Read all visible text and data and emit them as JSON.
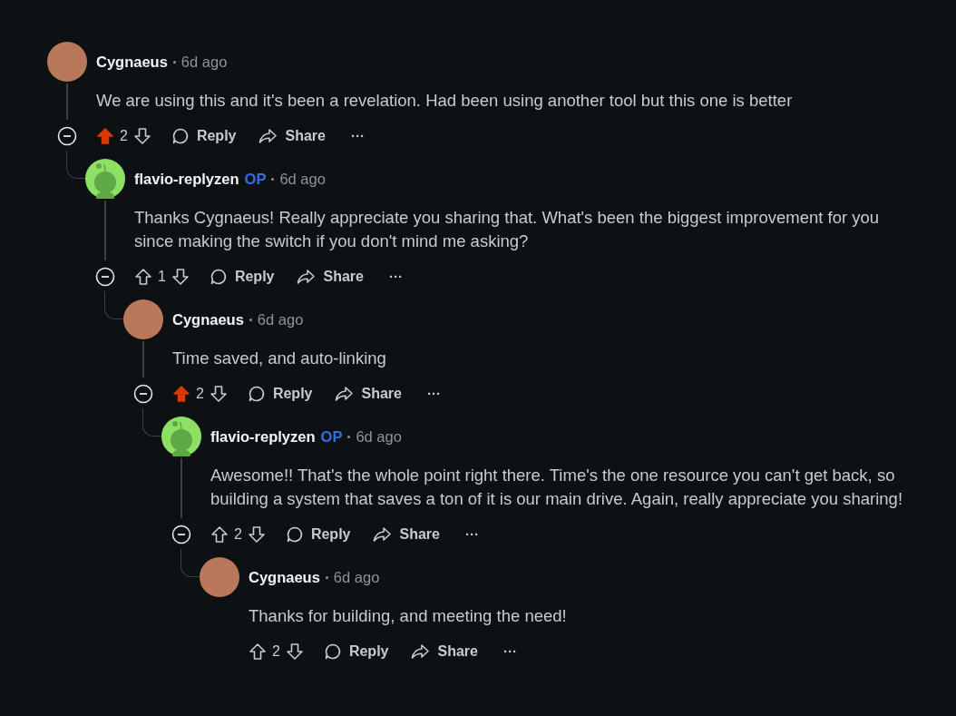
{
  "comments": [
    {
      "author": "Cygnaeus",
      "kind": "photo",
      "op": false,
      "time": "6d ago",
      "body": "We are using this and it's been a revelation. Had been using another tool but this one is better",
      "votes": "2",
      "upvoted": true,
      "actions": [
        "Reply",
        "Share"
      ],
      "more": "···",
      "children": [
        {
          "author": "flavio-replyzen",
          "kind": "snoo",
          "op": true,
          "op_label": "OP",
          "time": "6d ago",
          "body": "Thanks Cygnaeus! Really appreciate you sharing that. What's been the biggest improvement for you since making the switch if you don't mind me asking?",
          "votes": "1",
          "upvoted": false,
          "actions": [
            "Reply",
            "Share"
          ],
          "more": "···",
          "children": [
            {
              "author": "Cygnaeus",
              "kind": "photo",
              "op": false,
              "time": "6d ago",
              "body": "Time saved, and auto-linking",
              "votes": "2",
              "upvoted": true,
              "actions": [
                "Reply",
                "Share"
              ],
              "more": "···",
              "children": [
                {
                  "author": "flavio-replyzen",
                  "kind": "snoo",
                  "op": true,
                  "op_label": "OP",
                  "time": "6d ago",
                  "body": "Awesome!! That's the whole point right there. Time's the one resource you can't get back, so building a system that saves a ton of it is our main drive. Again, really appreciate you sharing!",
                  "votes": "2",
                  "upvoted": false,
                  "actions": [
                    "Reply",
                    "Share"
                  ],
                  "more": "···",
                  "children": [
                    {
                      "author": "Cygnaeus",
                      "kind": "photo",
                      "op": false,
                      "time": "6d ago",
                      "body": "Thanks for building, and meeting the need!",
                      "votes": "2",
                      "upvoted": false,
                      "actions": [
                        "Reply",
                        "Share"
                      ],
                      "more": "···"
                    }
                  ]
                }
              ]
            }
          ]
        }
      ]
    }
  ]
}
